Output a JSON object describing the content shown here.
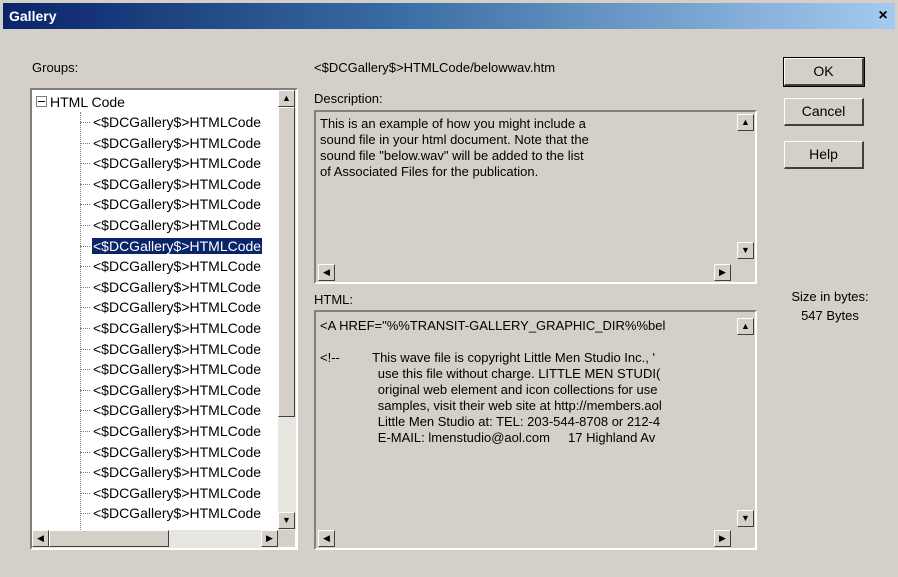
{
  "window": {
    "title": "Gallery",
    "close_label": "×"
  },
  "groups": {
    "label": "Groups:",
    "root_label": "HTML Code",
    "items": [
      "<$DCGallery$>HTMLCode",
      "<$DCGallery$>HTMLCode",
      "<$DCGallery$>HTMLCode",
      "<$DCGallery$>HTMLCode",
      "<$DCGallery$>HTMLCode",
      "<$DCGallery$>HTMLCode",
      "<$DCGallery$>HTMLCode",
      "<$DCGallery$>HTMLCode",
      "<$DCGallery$>HTMLCode",
      "<$DCGallery$>HTMLCode",
      "<$DCGallery$>HTMLCode",
      "<$DCGallery$>HTMLCode",
      "<$DCGallery$>HTMLCode",
      "<$DCGallery$>HTMLCode",
      "<$DCGallery$>HTMLCode",
      "<$DCGallery$>HTMLCode",
      "<$DCGallery$>HTMLCode",
      "<$DCGallery$>HTMLCode",
      "<$DCGallery$>HTMLCode",
      "<$DCGallery$>HTMLCode"
    ],
    "selected_index": 6
  },
  "file_path": "<$DCGallery$>HTMLCode/belowwav.htm",
  "description": {
    "label": "Description:",
    "lines": [
      "This is an example of how you might include a",
      "sound file in your html document. Note that the",
      "sound file \"below.wav\" will be added to the list",
      "of Associated Files for the publication."
    ]
  },
  "html_code": {
    "label": "HTML:",
    "lines": [
      "<A HREF=\"%%TRANSIT-GALLERY_GRAPHIC_DIR%%bel",
      "",
      "<!--         This wave file is copyright Little Men Studio Inc., '",
      "                use this file without charge. LITTLE MEN STUDI(",
      "                original web element and icon collections for use",
      "                samples, visit their web site at http://members.aol",
      "                Little Men Studio at: TEL: 203-544-8708 or 212-4",
      "                E-MAIL: lmenstudio@aol.com     17 Highland Av"
    ]
  },
  "buttons": {
    "ok": "OK",
    "cancel": "Cancel",
    "help": "Help"
  },
  "size": {
    "label": "Size in bytes:",
    "value": "547 Bytes"
  }
}
